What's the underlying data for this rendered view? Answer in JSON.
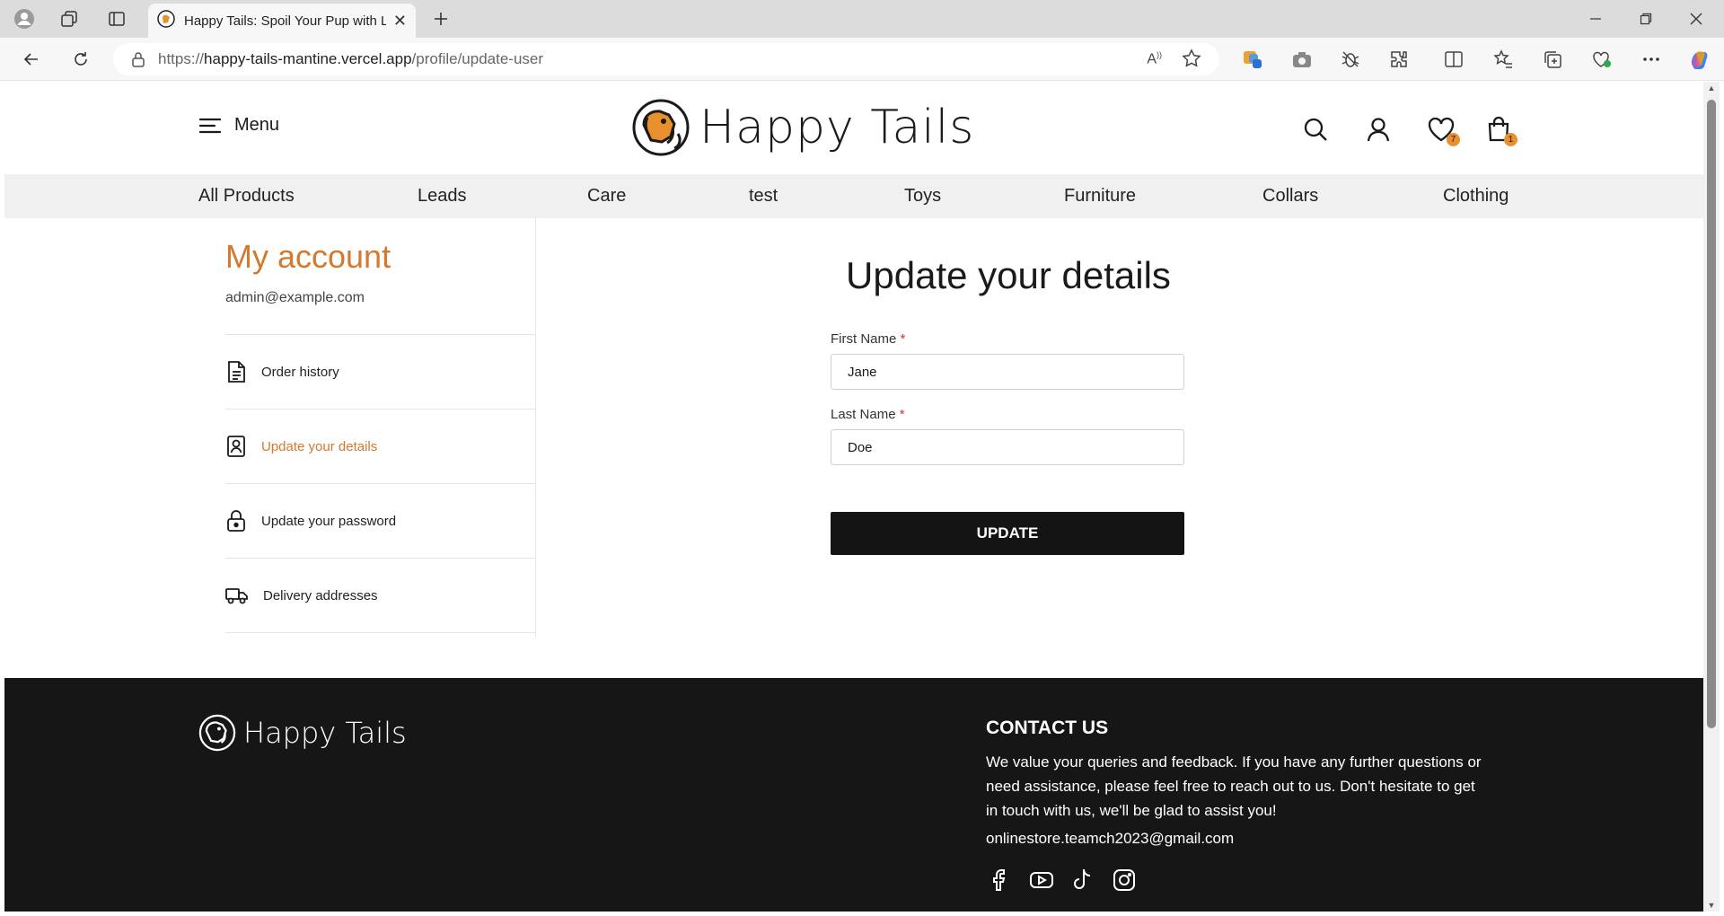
{
  "browser": {
    "tab_title": "Happy Tails: Spoil Your Pup with L",
    "url_scheme": "https://",
    "url_host": "happy-tails-mantine.vercel.app",
    "url_path": "/profile/update-user"
  },
  "header": {
    "menu_label": "Menu",
    "logo_text": "Happy Tails",
    "wishlist_count": "7",
    "cart_count": "1"
  },
  "categories": [
    "All Products",
    "Leads",
    "Care",
    "test",
    "Toys",
    "Furniture",
    "Collars",
    "Clothing"
  ],
  "account": {
    "title": "My account",
    "email": "admin@example.com",
    "items": [
      {
        "label": "Order history",
        "icon": "document-icon"
      },
      {
        "label": "Update your details",
        "icon": "user-card-icon"
      },
      {
        "label": "Update your password",
        "icon": "lock-icon"
      },
      {
        "label": "Delivery addresses",
        "icon": "truck-icon"
      }
    ]
  },
  "form": {
    "title": "Update your details",
    "first_name_label": "First Name",
    "first_name_value": "Jane",
    "last_name_label": "Last Name",
    "last_name_value": "Doe",
    "required_mark": "*",
    "submit_label": "UPDATE"
  },
  "footer": {
    "logo_text": "Happy Tails",
    "contact_title": "CONTACT US",
    "contact_text": "We value your queries and feedback. If you have any further questions or need assistance, please feel free to reach out to us. Don't hesitate to get in touch with us, we'll be glad to assist you!",
    "contact_email": "onlinestore.teamch2023@gmail.com",
    "socials": [
      "facebook-icon",
      "youtube-icon",
      "tiktok-icon",
      "instagram-icon"
    ]
  },
  "colors": {
    "accent": "#d4792e",
    "badge": "#e8902d",
    "footer_bg": "#161616"
  }
}
